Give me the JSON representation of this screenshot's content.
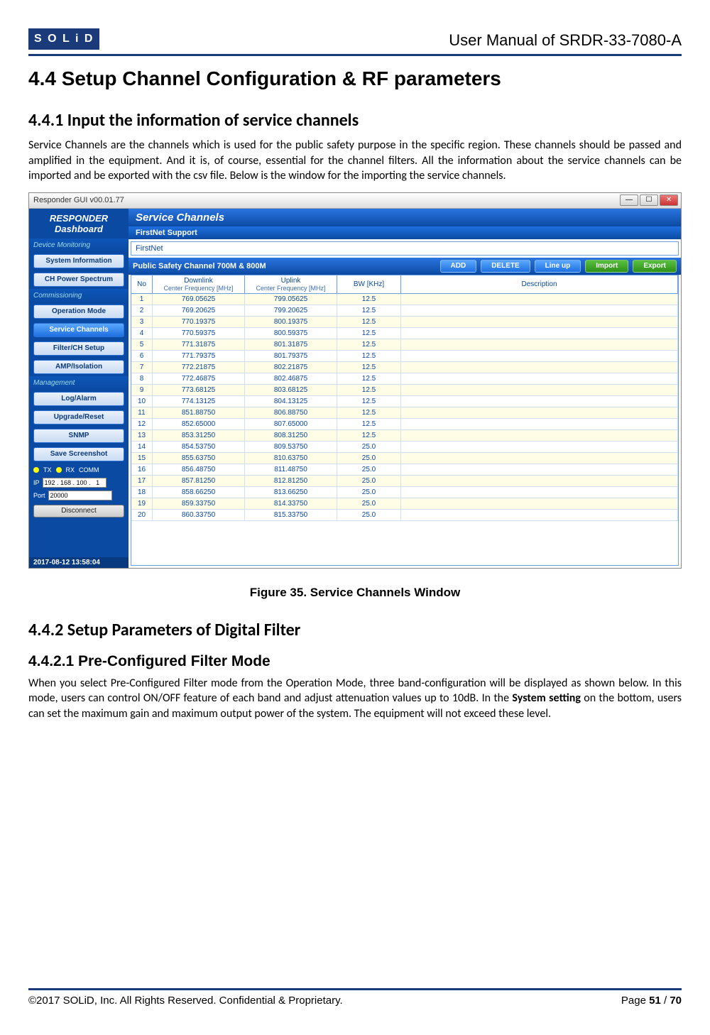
{
  "header": {
    "logo": "S O L i D",
    "doc_title": "User Manual of SRDR-33-7080-A"
  },
  "sections": {
    "s44": "4.4   Setup Channel Configuration & RF parameters",
    "s441": "4.4.1 Input the information of service channels",
    "p441": "Service Channels are the channels which is used for the public safety purpose in the specific region. These channels should be passed and amplified in the equipment. And it is, of course, essential for the channel filters. All the information about the service channels can be imported and be exported with the csv file. Below is the window for the importing the service channels.",
    "fig35": "Figure 35. Service Channels Window",
    "s442": "4.4.2 Setup Parameters of Digital Filter",
    "s4421": "4.4.2.1  Pre-Configured Filter Mode",
    "p4421a": "When you select Pre-Configured Filter mode from the Operation Mode, three band-configuration will be displayed as shown below. In this mode, users can control ON/OFF feature of each band and adjust attenuation values up to 10dB. In the ",
    "p4421b": "System setting",
    "p4421c": " on the bottom, users can set the maximum gain and maximum output power of the system. The equipment will not exceed these level."
  },
  "footer": {
    "left": "©2017 SOLiD, Inc. All Rights Reserved. Confidential & Proprietary.",
    "right_a": "Page ",
    "right_b": "51",
    "right_c": " / ",
    "right_d": "70"
  },
  "shot": {
    "win_title": "Responder GUI v00.01.77",
    "brand1": "RESPONDER",
    "brand2": "Dashboard",
    "groups": {
      "g1": "Device Monitoring",
      "g2": "Commissioning",
      "g3": "Management"
    },
    "side_btns": {
      "b1": "System Information",
      "b2": "CH Power Spectrum",
      "b3": "Operation Mode",
      "b4": "Service Channels",
      "b5": "Filter/CH Setup",
      "b6": "AMP/Isolation",
      "b7": "Log/Alarm",
      "b8": "Upgrade/Reset",
      "b9": "SNMP",
      "b10": "Save Screenshot"
    },
    "led": {
      "tx": "TX",
      "rx": "RX",
      "comm": "COMM"
    },
    "ip_label": "IP",
    "ip_value": "192 . 168 . 100 .   1",
    "port_label": "Port",
    "port_value": "20000",
    "disconnect": "Disconnect",
    "timestamp": "2017-08-12 13:58:04",
    "main_title": "Service Channels",
    "firstnet_hdr": "FirstNet Support",
    "firstnet_val": "FirstNet",
    "bar2_label": "Public Safety Channel 700M & 800M",
    "btn_add": "ADD",
    "btn_del": "DELETE",
    "btn_lineup": "Line up",
    "btn_import": "Import",
    "btn_export": "Export",
    "th_no": "No",
    "th_dl1": "Downlink",
    "th_dl2": "Center Frequency [MHz]",
    "th_ul1": "Uplink",
    "th_ul2": "Center Frequency [MHz]",
    "th_bw": "BW [KHz]",
    "th_desc": "Description",
    "rows": [
      {
        "no": "1",
        "dl": "769.05625",
        "ul": "799.05625",
        "bw": "12.5"
      },
      {
        "no": "2",
        "dl": "769.20625",
        "ul": "799.20625",
        "bw": "12.5"
      },
      {
        "no": "3",
        "dl": "770.19375",
        "ul": "800.19375",
        "bw": "12.5"
      },
      {
        "no": "4",
        "dl": "770.59375",
        "ul": "800.59375",
        "bw": "12.5"
      },
      {
        "no": "5",
        "dl": "771.31875",
        "ul": "801.31875",
        "bw": "12.5"
      },
      {
        "no": "6",
        "dl": "771.79375",
        "ul": "801.79375",
        "bw": "12.5"
      },
      {
        "no": "7",
        "dl": "772.21875",
        "ul": "802.21875",
        "bw": "12.5"
      },
      {
        "no": "8",
        "dl": "772.46875",
        "ul": "802.46875",
        "bw": "12.5"
      },
      {
        "no": "9",
        "dl": "773.68125",
        "ul": "803.68125",
        "bw": "12.5"
      },
      {
        "no": "10",
        "dl": "774.13125",
        "ul": "804.13125",
        "bw": "12.5"
      },
      {
        "no": "11",
        "dl": "851.88750",
        "ul": "806.88750",
        "bw": "12.5"
      },
      {
        "no": "12",
        "dl": "852.65000",
        "ul": "807.65000",
        "bw": "12.5"
      },
      {
        "no": "13",
        "dl": "853.31250",
        "ul": "808.31250",
        "bw": "12.5"
      },
      {
        "no": "14",
        "dl": "854.53750",
        "ul": "809.53750",
        "bw": "25.0"
      },
      {
        "no": "15",
        "dl": "855.63750",
        "ul": "810.63750",
        "bw": "25.0"
      },
      {
        "no": "16",
        "dl": "856.48750",
        "ul": "811.48750",
        "bw": "25.0"
      },
      {
        "no": "17",
        "dl": "857.81250",
        "ul": "812.81250",
        "bw": "25.0"
      },
      {
        "no": "18",
        "dl": "858.66250",
        "ul": "813.66250",
        "bw": "25.0"
      },
      {
        "no": "19",
        "dl": "859.33750",
        "ul": "814.33750",
        "bw": "25.0"
      },
      {
        "no": "20",
        "dl": "860.33750",
        "ul": "815.33750",
        "bw": "25.0"
      }
    ]
  }
}
